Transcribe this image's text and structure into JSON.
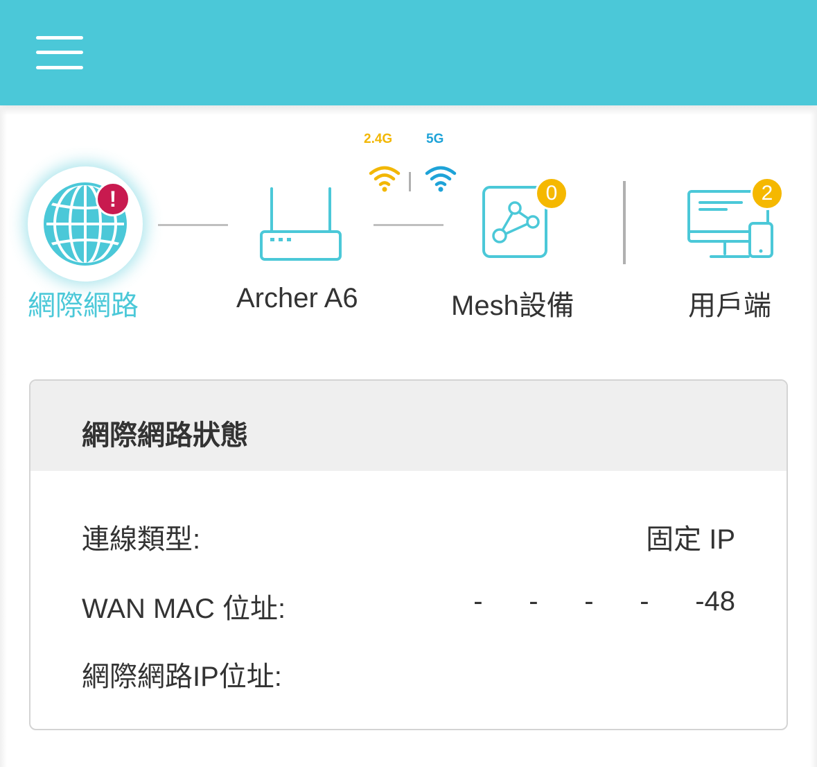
{
  "header": {
    "menu_icon": "hamburger-menu-icon",
    "background_color": "#4bc8d8"
  },
  "topology": {
    "bands": {
      "band_24g": "2.4G",
      "band_5g": "5G"
    },
    "nodes": [
      {
        "id": "internet",
        "label": "網際網路",
        "icon": "globe-icon",
        "alert": "!",
        "active": true
      },
      {
        "id": "router",
        "label": "Archer A6",
        "icon": "router-icon"
      },
      {
        "id": "mesh",
        "label": "Mesh設備",
        "icon": "mesh-device-icon",
        "count": "0"
      },
      {
        "id": "clients",
        "label": "用戶端",
        "icon": "clients-devices-icon",
        "count": "2"
      }
    ],
    "colors": {
      "accent": "#4bc8d8",
      "alert": "#c81a4f",
      "badge": "#f5b800",
      "band_24g": "#f2b705",
      "band_5g": "#1ea3d8"
    }
  },
  "status_card": {
    "title": "網際網路狀態",
    "rows": [
      {
        "label": "連線類型:",
        "value": "固定 IP"
      },
      {
        "label": "WAN MAC 位址:",
        "value": "-      -      -      -      -48"
      },
      {
        "label": "網際網路IP位址:",
        "value": ""
      }
    ]
  }
}
